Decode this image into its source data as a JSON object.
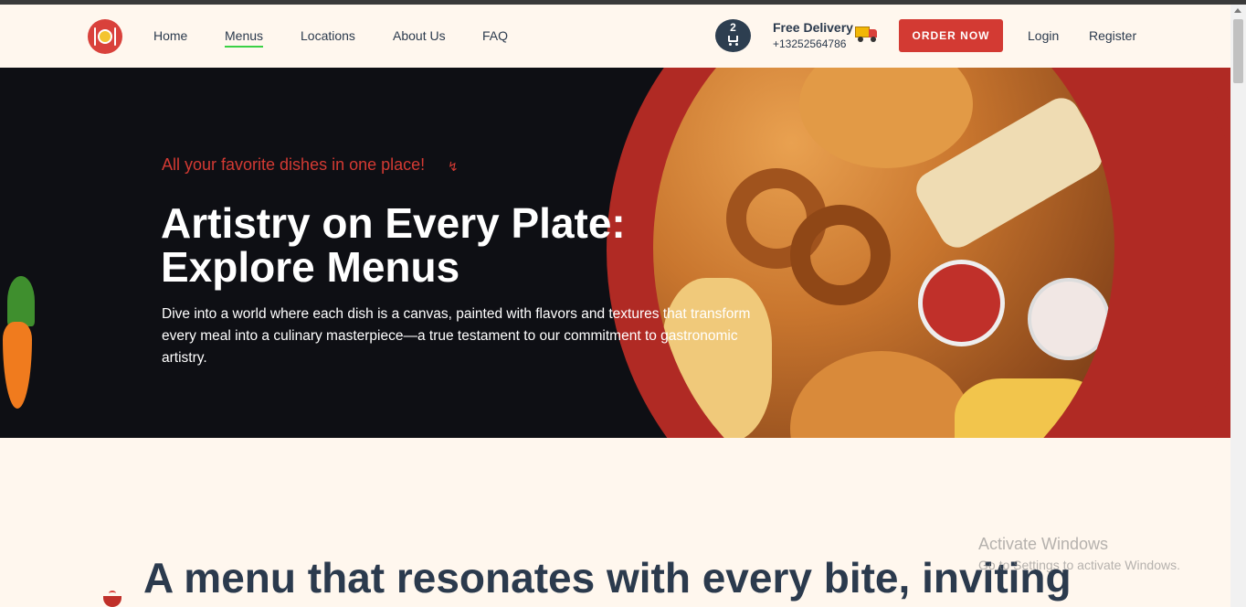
{
  "nav": {
    "links": [
      {
        "label": "Home"
      },
      {
        "label": "Menus"
      },
      {
        "label": "Locations"
      },
      {
        "label": "About Us"
      },
      {
        "label": "FAQ"
      }
    ],
    "cart_count": "2",
    "delivery_title": "Free Delivery",
    "delivery_phone": "+13252564786",
    "order_label": "ORDER NOW",
    "login_label": "Login",
    "register_label": "Register"
  },
  "hero": {
    "tagline": "All your favorite dishes in one place!",
    "title_line1": "Artistry on Every Plate:",
    "title_line2": "Explore Menus",
    "description": "Dive into a world where each dish is a canvas, painted with flavors and textures that transform every meal into a culinary masterpiece—a true testament to our commitment to gastronomic artistry."
  },
  "section": {
    "title": "A menu that resonates with every bite, inviting"
  },
  "watermark": {
    "title": "Activate Windows",
    "subtitle": "Go to Settings to activate Windows."
  },
  "colors": {
    "accent_red": "#d33a33",
    "hero_dark": "#0e0f14",
    "hero_red": "#b02a24",
    "text_navy": "#2b3a4d",
    "active_underline": "#3bd146",
    "background": "#fff7ee"
  }
}
